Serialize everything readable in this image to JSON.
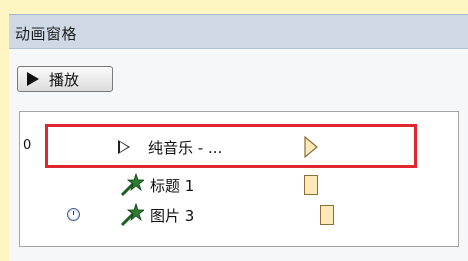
{
  "pane": {
    "title": "动画窗格",
    "play_button_label": "播放"
  },
  "items": [
    {
      "number": "0",
      "label": "纯音乐 - ...",
      "icon": "play-triangle-icon"
    },
    {
      "label": "标题 1",
      "icon": "star-effect-icon"
    },
    {
      "label": "图片 3",
      "icon": "star-effect-icon",
      "trigger_icon": "clock-icon"
    }
  ],
  "colors": {
    "header_bg": "#cfd9e6",
    "highlight": "#e0262e",
    "timeline_bar": "#fde9b5",
    "outer_bg": "#fdf6c3"
  }
}
